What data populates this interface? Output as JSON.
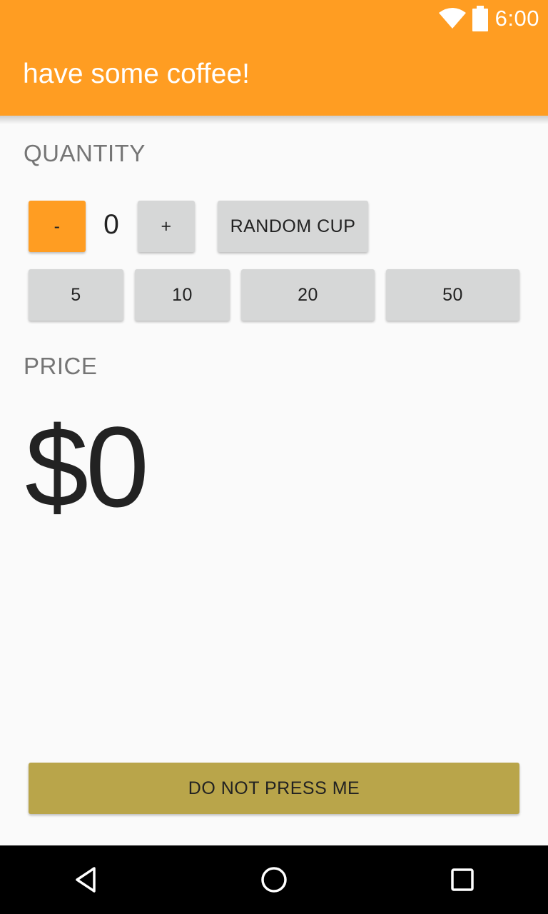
{
  "status_bar": {
    "time": "6:00",
    "icons": [
      "wifi-icon",
      "battery-icon"
    ]
  },
  "app_bar": {
    "title": "have some coffee!",
    "color": "#ff9d22"
  },
  "quantity": {
    "label": "QUANTITY",
    "decrement_label": "-",
    "value": "0",
    "increment_label": "+",
    "random_label": "RANDOM CUP",
    "presets": [
      "5",
      "10",
      "20",
      "50"
    ]
  },
  "price": {
    "label": "PRICE",
    "value": "$0"
  },
  "danger_button": {
    "label": "DO NOT PRESS ME",
    "color": "#b9a54a"
  },
  "nav_bar": {
    "icons": [
      "back-icon",
      "home-icon",
      "recents-icon"
    ]
  }
}
